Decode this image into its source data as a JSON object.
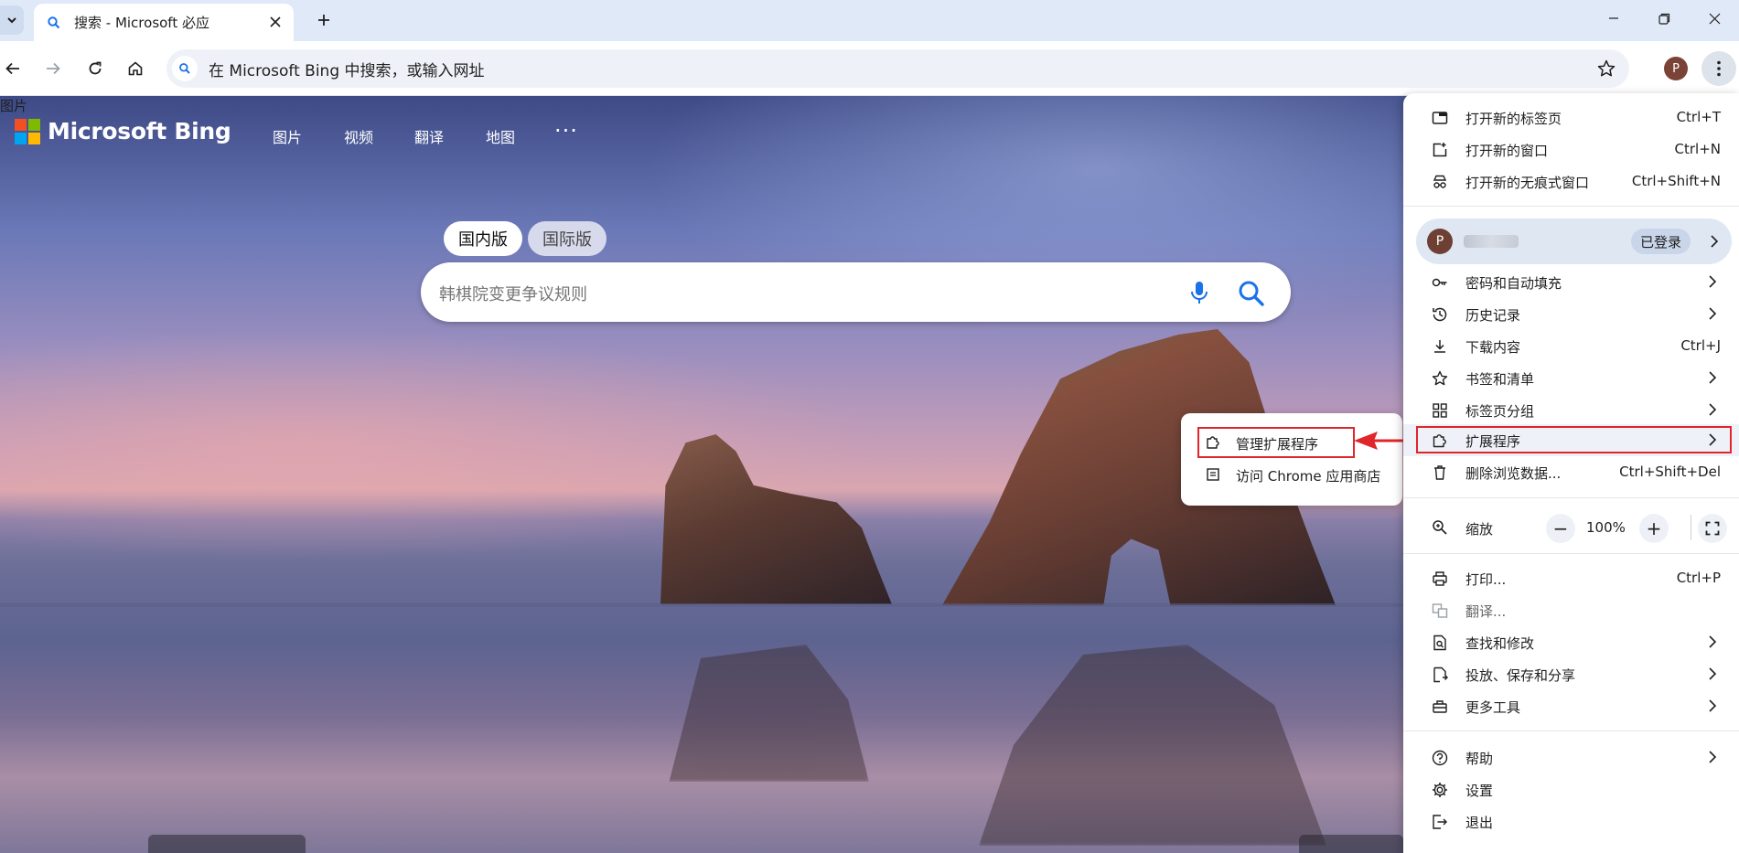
{
  "browser": {
    "tab_title": "搜索 - Microsoft 必应",
    "address_placeholder": "在 Microsoft Bing 中搜索，或输入网址",
    "profile_initial": "P"
  },
  "bing": {
    "logo_text": "Microsoft Bing",
    "nav": [
      "图片",
      "视频",
      "翻译",
      "地图"
    ],
    "more": "···",
    "region_tabs": [
      "国内版",
      "国际版"
    ],
    "search_placeholder": "韩棋院变更争议规则"
  },
  "menu": {
    "new_tab": "打开新的标签页",
    "new_tab_shortcut": "Ctrl+T",
    "new_window": "打开新的窗口",
    "new_window_shortcut": "Ctrl+N",
    "incognito": "打开新的无痕式窗口",
    "incognito_shortcut": "Ctrl+Shift+N",
    "profile_initial": "P",
    "signed_in": "已登录",
    "passwords": "密码和自动填充",
    "history": "历史记录",
    "downloads": "下载内容",
    "downloads_shortcut": "Ctrl+J",
    "bookmarks": "书签和清单",
    "tab_groups": "标签页分组",
    "extensions": "扩展程序",
    "clear_data": "删除浏览数据...",
    "clear_data_shortcut": "Ctrl+Shift+Del",
    "zoom": "缩放",
    "zoom_minus": "−",
    "zoom_value": "100%",
    "zoom_plus": "+",
    "print": "打印...",
    "print_shortcut": "Ctrl+P",
    "translate": "翻译...",
    "find": "查找和修改",
    "cast": "投放、保存和分享",
    "more_tools": "更多工具",
    "help": "帮助",
    "settings": "设置",
    "exit": "退出"
  },
  "submenu": {
    "manage_extensions": "管理扩展程序",
    "visit_store": "访问 Chrome 应用商店"
  },
  "colors": {
    "highlight": "#e0252b",
    "accent": "#1a73e8"
  }
}
